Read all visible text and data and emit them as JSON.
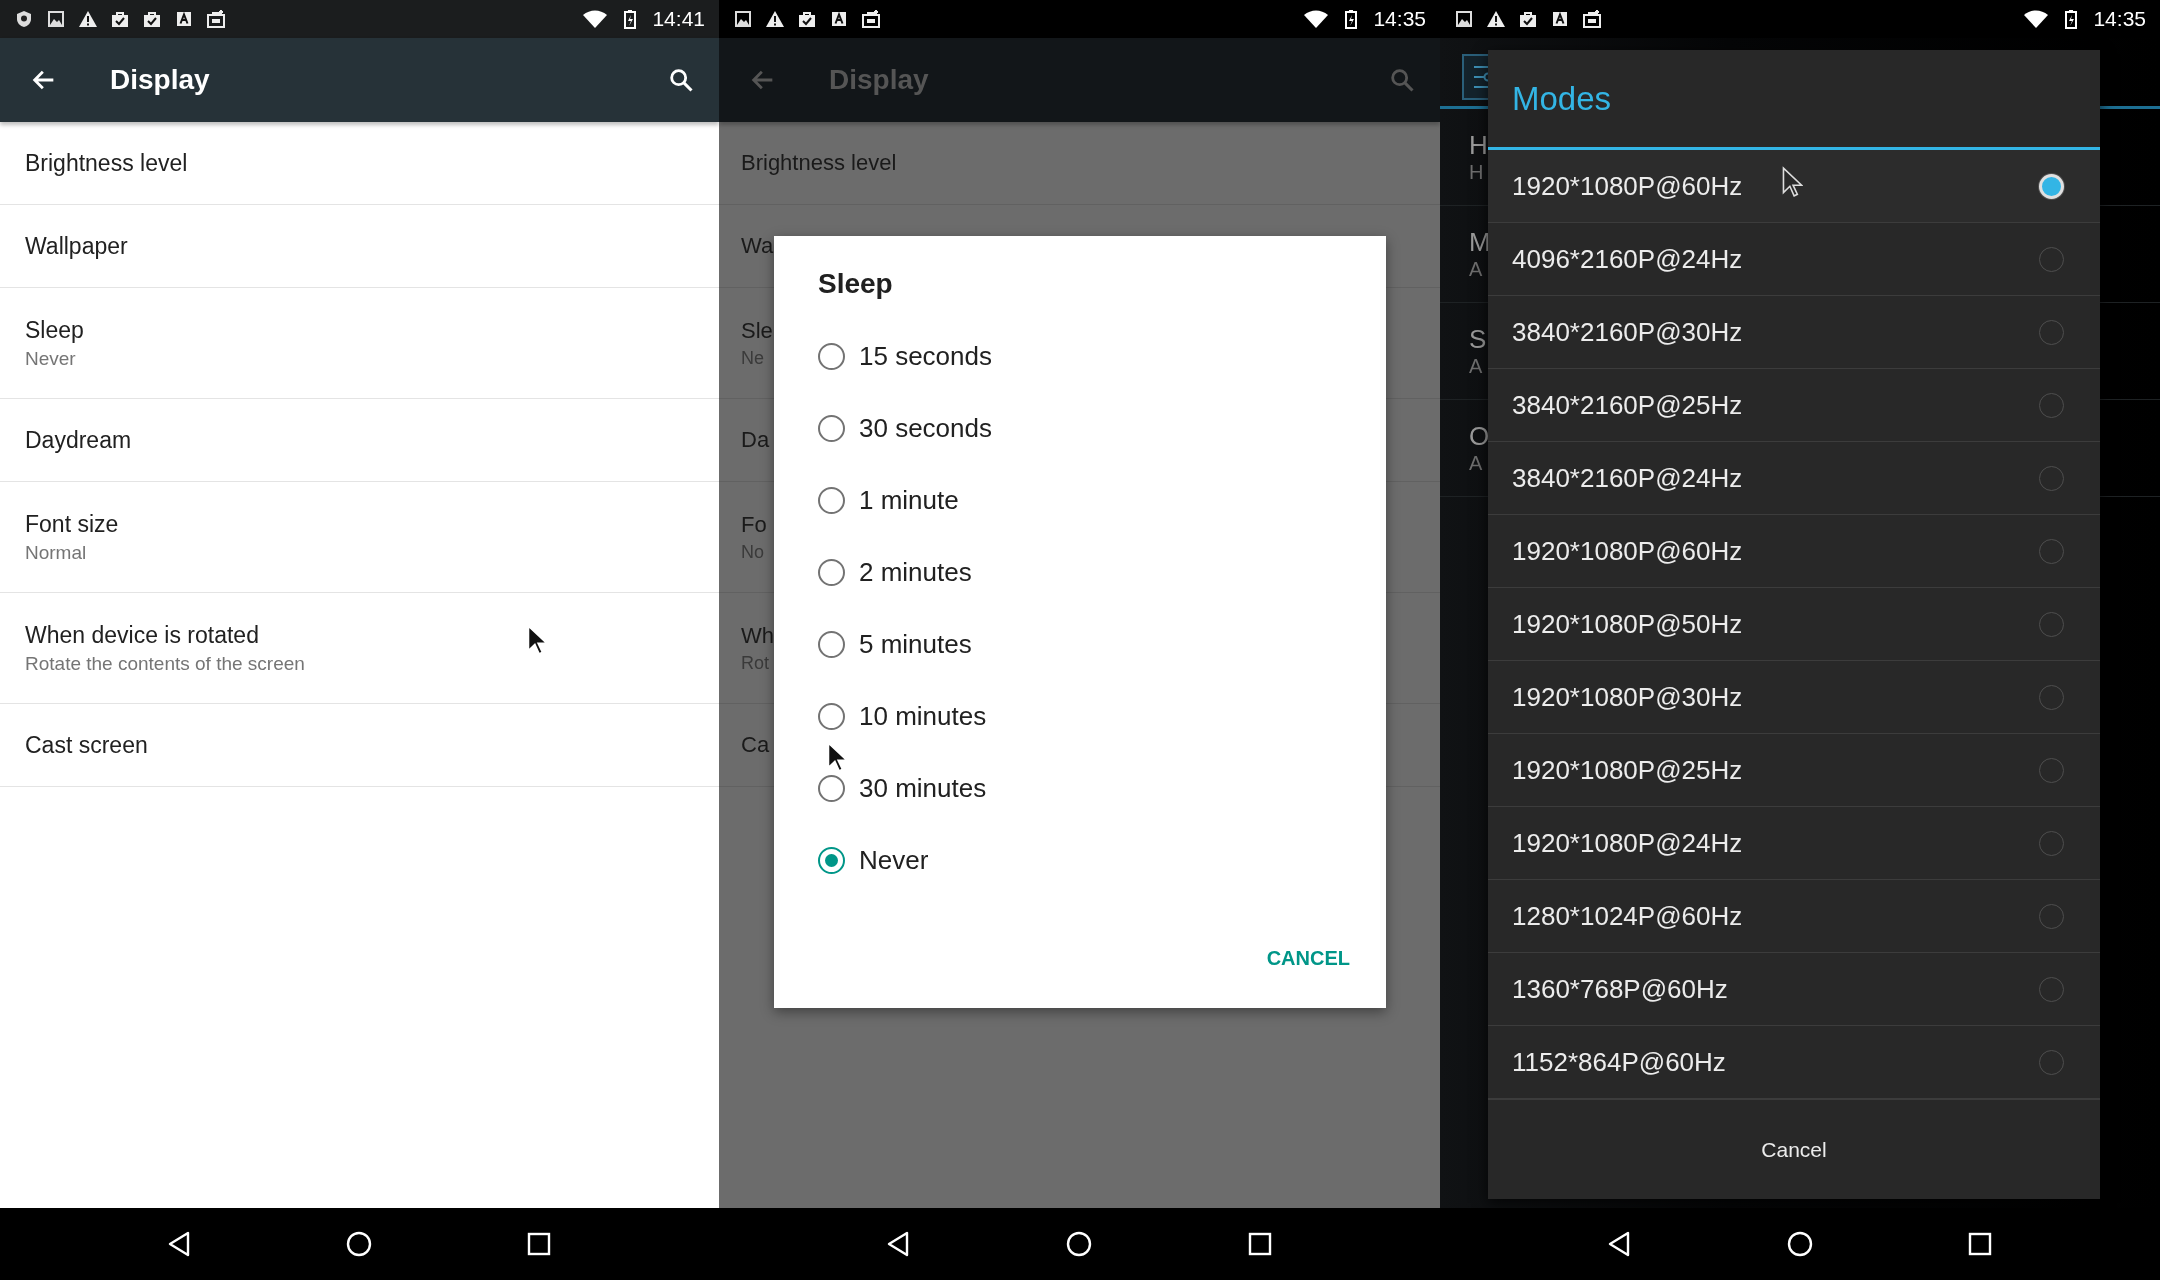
{
  "panels": [
    {
      "kind": "settings",
      "status_bar": {
        "notifications": [
          {
            "kind": "shield"
          },
          {
            "kind": "image"
          },
          {
            "kind": "warning"
          },
          {
            "kind": "bag"
          },
          {
            "kind": "bag"
          },
          {
            "kind": "letter"
          },
          {
            "kind": "briefcase"
          }
        ],
        "time": "14:41"
      },
      "app_bar": {
        "title": "Display"
      },
      "items": [
        {
          "title": "Brightness level"
        },
        {
          "title": "Wallpaper"
        },
        {
          "title": "Sleep",
          "summary": "Never"
        },
        {
          "title": "Daydream"
        },
        {
          "title": "Font size",
          "summary": "Normal"
        },
        {
          "title": "When device is rotated",
          "summary": "Rotate the contents of the screen"
        },
        {
          "title": "Cast screen"
        }
      ]
    },
    {
      "kind": "settings_dialog",
      "status_bar": {
        "notifications": [
          {
            "kind": "image"
          },
          {
            "kind": "warning"
          },
          {
            "kind": "bag"
          },
          {
            "kind": "letter"
          },
          {
            "kind": "briefcase"
          }
        ],
        "time": "14:35"
      },
      "app_bar": {
        "title": "Display"
      },
      "items": [
        {
          "title": "Brightness level"
        },
        {
          "title": "Wa"
        },
        {
          "title": "Sle",
          "summary": "Ne"
        },
        {
          "title": "Da"
        },
        {
          "title": "Fo",
          "summary": "No"
        },
        {
          "title": "Wh",
          "summary": "Rot"
        },
        {
          "title": "Ca"
        }
      ],
      "dialog": {
        "title": "Sleep",
        "options": [
          {
            "label": "15 seconds",
            "selected": false
          },
          {
            "label": "30 seconds",
            "selected": false
          },
          {
            "label": "1 minute",
            "selected": false
          },
          {
            "label": "2 minutes",
            "selected": false
          },
          {
            "label": "5 minutes",
            "selected": false
          },
          {
            "label": "10 minutes",
            "selected": false
          },
          {
            "label": "30 minutes",
            "selected": false
          },
          {
            "label": "Never",
            "selected": true
          }
        ],
        "button": "CANCEL"
      }
    },
    {
      "kind": "tv_dialog",
      "status_bar": {
        "notifications": [
          {
            "kind": "image"
          },
          {
            "kind": "warning"
          },
          {
            "kind": "bag"
          },
          {
            "kind": "letter"
          },
          {
            "kind": "briefcase"
          }
        ],
        "time": "14:35"
      },
      "items": [
        {
          "title": "H",
          "summary": "H"
        },
        {
          "title": "M",
          "summary": "A"
        },
        {
          "title": "S",
          "summary": "A"
        },
        {
          "title": "O",
          "summary": "A"
        }
      ],
      "dialog": {
        "title": "Modes",
        "options": [
          {
            "label": "1920*1080P@60Hz",
            "selected": true
          },
          {
            "label": "4096*2160P@24Hz",
            "selected": false
          },
          {
            "label": "3840*2160P@30Hz",
            "selected": false
          },
          {
            "label": "3840*2160P@25Hz",
            "selected": false
          },
          {
            "label": "3840*2160P@24Hz",
            "selected": false
          },
          {
            "label": "1920*1080P@60Hz",
            "selected": false
          },
          {
            "label": "1920*1080P@50Hz",
            "selected": false
          },
          {
            "label": "1920*1080P@30Hz",
            "selected": false
          },
          {
            "label": "1920*1080P@25Hz",
            "selected": false
          },
          {
            "label": "1920*1080P@24Hz",
            "selected": false
          },
          {
            "label": "1280*1024P@60Hz",
            "selected": false
          },
          {
            "label": "1360*768P@60Hz",
            "selected": false
          },
          {
            "label": "1152*864P@60Hz",
            "selected": false
          }
        ],
        "button": "Cancel"
      }
    }
  ]
}
